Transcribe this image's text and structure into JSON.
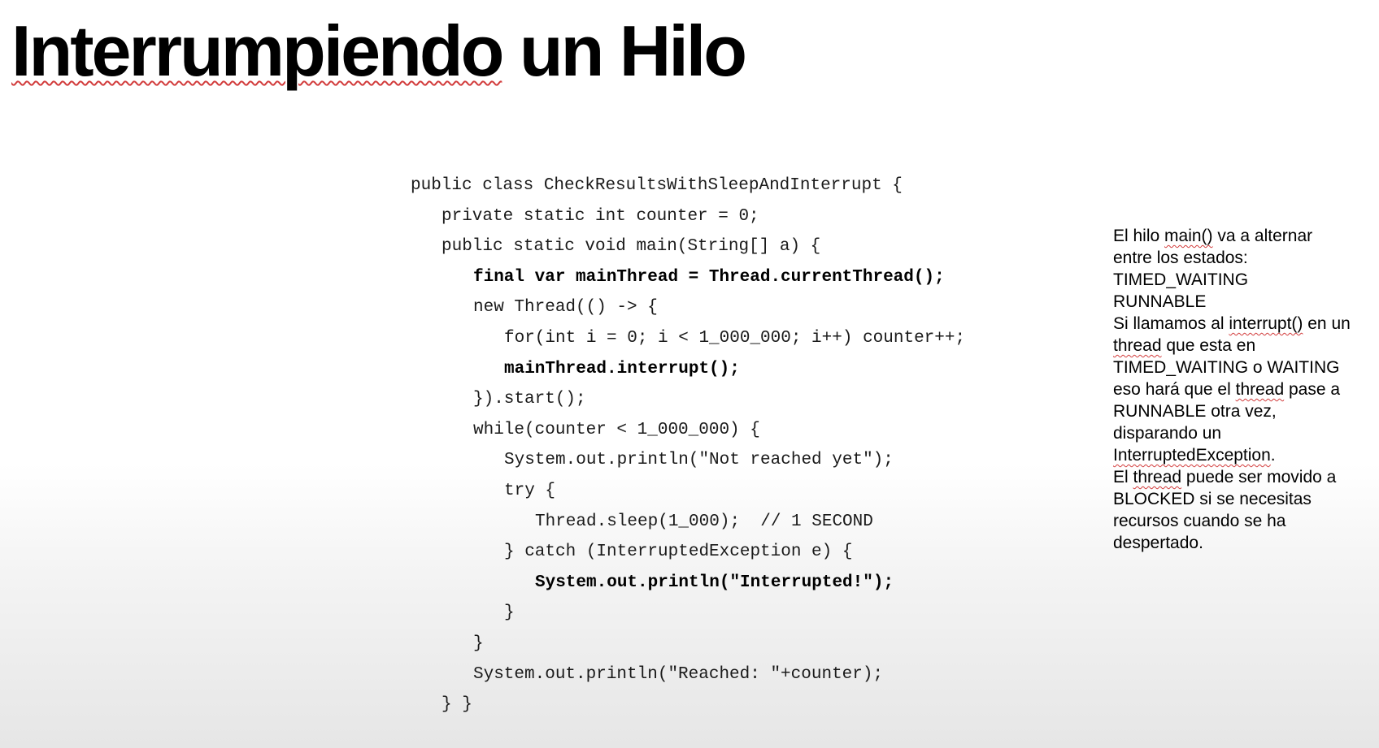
{
  "title": {
    "word1": "Interrumpiendo",
    "word2": "un Hilo"
  },
  "code": {
    "lines": [
      "public class CheckResultsWithSleepAndInterrupt {",
      "private static int counter = 0;",
      "public static void main(String[] a) {",
      "final var mainThread = Thread.currentThread();",
      "new Thread(() -> {",
      "for(int i = 0; i < 1_000_000; i++) counter++;",
      "mainThread.interrupt();",
      "}).start();",
      "while(counter < 1_000_000) {",
      "System.out.println(\"Not reached yet\");",
      "try {",
      "Thread.sleep(1_000);  // 1 SECOND",
      "} catch (InterruptedException e) {",
      "System.out.println(\"Interrupted!\");",
      "}",
      "}",
      "System.out.println(\"Reached: \"+counter);",
      "} }"
    ]
  },
  "notes": {
    "l1_a": "El hilo ",
    "l1_b": "main()",
    "l1_c": " va a alternar",
    "l2": "entre los estados:",
    "l3": "TIMED_WAITING",
    "l4": "RUNNABLE",
    "l5_a": "Si llamamos al ",
    "l5_b": "interrupt()",
    "l5_c": " en un",
    "l6_a": "thread",
    "l6_b": " que esta en",
    "l7": "TIMED_WAITING o WAITING",
    "l8_a": "eso hará que el ",
    "l8_b": "thread",
    "l8_c": " pase a",
    "l9": "RUNNABLE otra vez,",
    "l10": "disparando un",
    "l11_a": "InterruptedException",
    "l11_b": ".",
    "l12_a": "El ",
    "l12_b": "thread",
    "l12_c": " puede ser movido a",
    "l13": "BLOCKED si se necesitas",
    "l14": "recursos cuando se ha",
    "l15": "despertado."
  }
}
